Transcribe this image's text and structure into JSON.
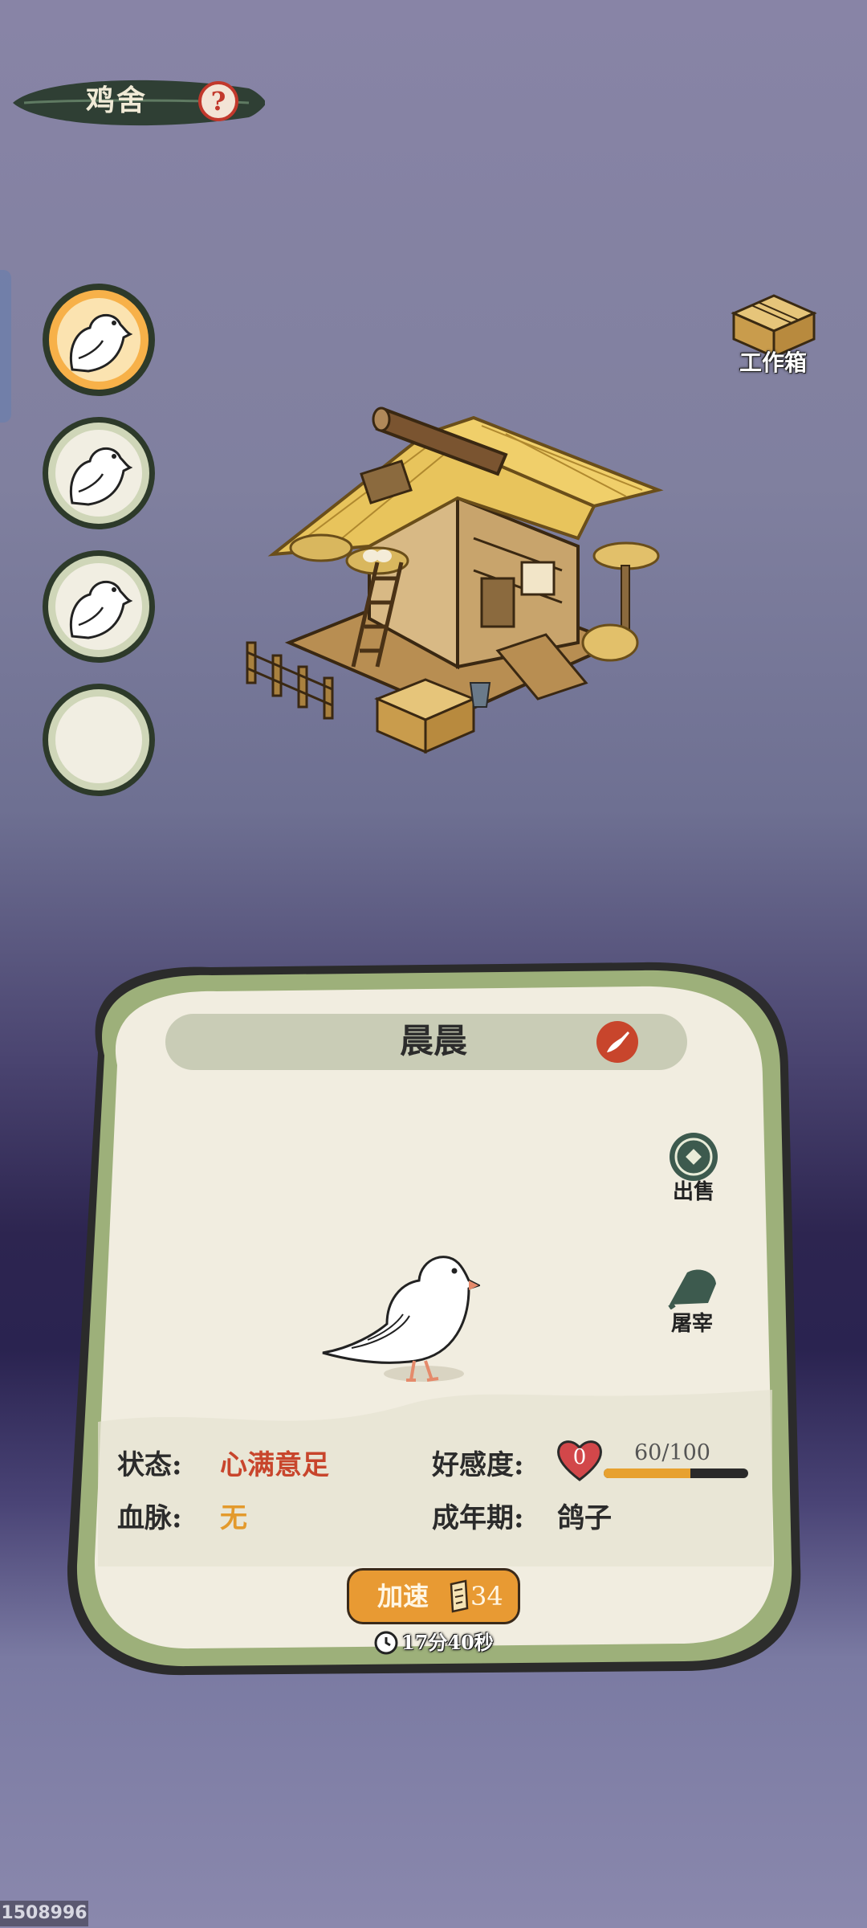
{
  "header": {
    "title": "鸡舍",
    "help_icon": "question-icon"
  },
  "slots": [
    {
      "state": "selected",
      "icon": "pigeon-icon"
    },
    {
      "state": "normal",
      "icon": "pigeon-icon"
    },
    {
      "state": "normal",
      "icon": "pigeon-icon"
    },
    {
      "state": "empty"
    }
  ],
  "workbox": {
    "label": "工作箱",
    "icon": "crate-icon"
  },
  "panel": {
    "name": "晨晨",
    "rename_icon": "brush-icon",
    "sell_label": "出售",
    "slaughter_label": "屠宰",
    "status_label": "状态:",
    "status_value": "心满意足",
    "bloodline_label": "血脉:",
    "bloodline_value": "无",
    "affection_label": "好感度:",
    "affection_level": "0",
    "affection_text": "60/100",
    "affection_fraction": 0.6,
    "adult_label": "成年期:",
    "adult_value": "鸽子",
    "speedup_label": "加速",
    "speedup_cost": "34",
    "timer": "17分40秒"
  },
  "build_id": "1508996",
  "colors": {
    "status_value": "#c8452c",
    "bloodline_value": "#e39a2c",
    "speed_button": "#e89a33",
    "panel_border": "#9db07a",
    "panel_bg": "#f1ede0"
  }
}
